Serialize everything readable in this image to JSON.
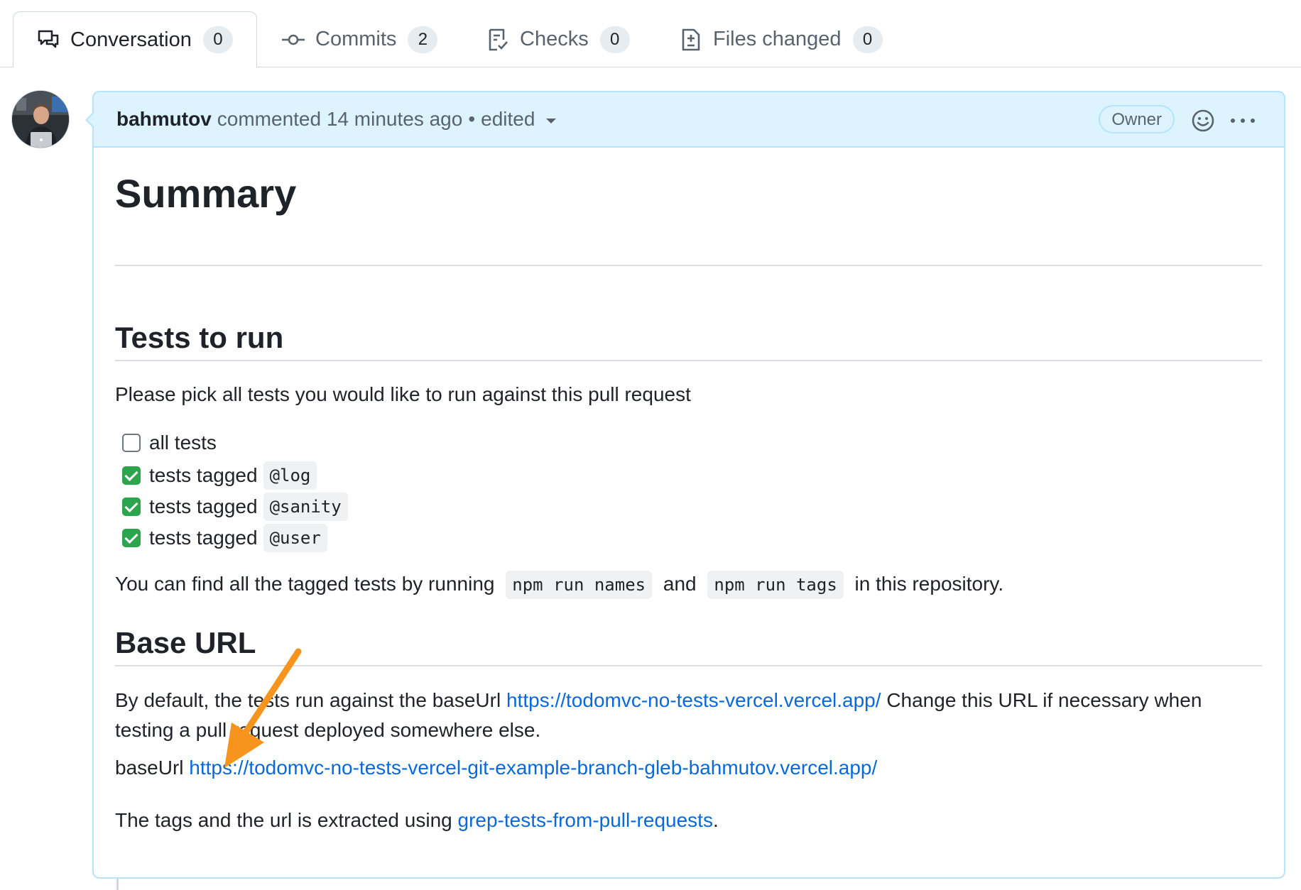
{
  "tabs": [
    {
      "label": "Conversation",
      "count": "0",
      "icon": "comment-discussion-icon"
    },
    {
      "label": "Commits",
      "count": "2",
      "icon": "commit-icon"
    },
    {
      "label": "Checks",
      "count": "0",
      "icon": "checklist-icon"
    },
    {
      "label": "Files changed",
      "count": "0",
      "icon": "file-diff-icon"
    }
  ],
  "comment": {
    "author": "bahmutov",
    "action": "commented",
    "time": "14 minutes ago",
    "separator": "•",
    "edited": "edited",
    "badge": "Owner"
  },
  "body": {
    "h1": "Summary",
    "h2_tests": "Tests to run",
    "pick_text": "Please pick all tests you would like to run against this pull request",
    "tasks": [
      {
        "text": "all tests",
        "code": "",
        "checked": false
      },
      {
        "text": "tests tagged",
        "code": "@log",
        "checked": true
      },
      {
        "text": "tests tagged",
        "code": "@sanity",
        "checked": true
      },
      {
        "text": "tests tagged",
        "code": "@user",
        "checked": true
      }
    ],
    "find_pre": "You can find all the tagged tests by running",
    "find_code1": "npm run names",
    "find_mid": "and",
    "find_code2": "npm run tags",
    "find_post": "in this repository.",
    "h2_base": "Base URL",
    "default_pre": "By default, the tests run against the baseUrl",
    "default_link": "https://todomvc-no-tests-vercel.vercel.app/",
    "default_post": "Change this URL if necessary when testing a pull request deployed somewhere else.",
    "baseurl_label": "baseUrl",
    "baseurl_link": "https://todomvc-no-tests-vercel-git-example-branch-gleb-bahmutov.vercel.app/",
    "tags_pre": "The tags and the url is extracted using",
    "tags_link": "grep-tests-from-pull-requests",
    "tags_post": "."
  },
  "colors": {
    "link": "#0969da",
    "header_bg": "#ddf4ff",
    "check_green": "#2da44e",
    "annotation_arrow": "#f7941d"
  }
}
